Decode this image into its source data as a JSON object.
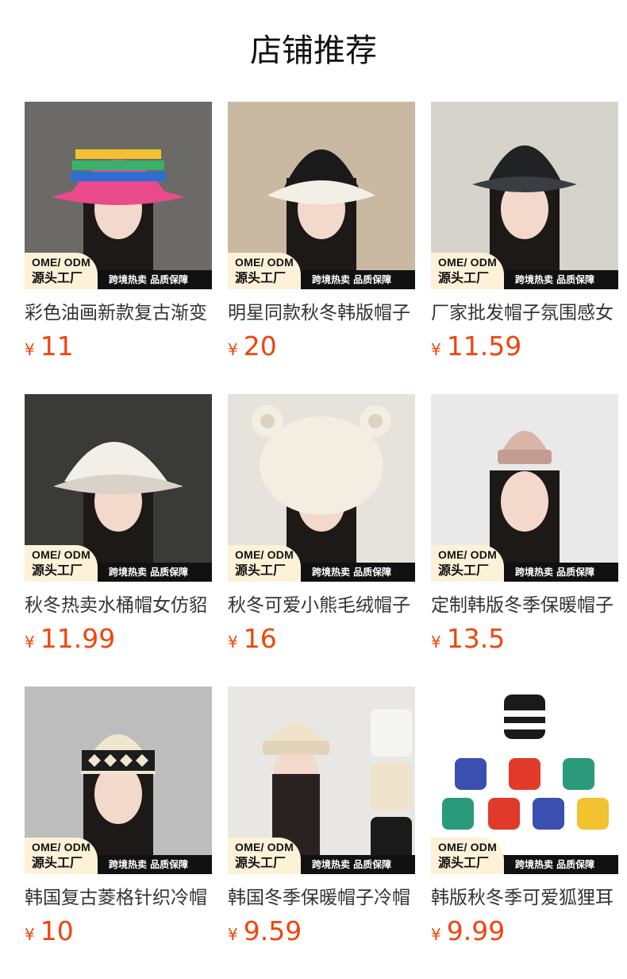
{
  "header": {
    "title": "店铺推荐"
  },
  "badge": {
    "line1": "OME/ ODM",
    "line2": "源头工厂",
    "text": "跨境热卖 品质保障"
  },
  "currency": "¥",
  "products": [
    {
      "name": "彩色油画新款复古渐变",
      "price": "11",
      "image": "rainbow-knit-bucket-hat",
      "colors": [
        "#e84a8a",
        "#f2c230",
        "#3ab06a",
        "#2c6fd1",
        "#f06a2a"
      ]
    },
    {
      "name": "明星同款秋冬韩版帽子",
      "price": "20",
      "image": "black-white-fluffy-bucket-hat",
      "colors": [
        "#1a1a1a",
        "#f4efe6"
      ]
    },
    {
      "name": "厂家批发帽子氛围感女",
      "price": "11.59",
      "image": "black-denim-bucket-hat",
      "colors": [
        "#202224",
        "#3a3d42"
      ]
    },
    {
      "name": "秋冬热卖水桶帽女仿貂",
      "price": "11.99",
      "image": "white-fur-bucket-hat",
      "colors": [
        "#f2eee8",
        "#d9d2c8"
      ]
    },
    {
      "name": "秋冬可爱小熊毛绒帽子",
      "price": "16",
      "image": "bear-ear-plush-hat",
      "colors": [
        "#f3ede2",
        "#ddd2bf"
      ]
    },
    {
      "name": "定制韩版冬季保暖帽子",
      "price": "13.5",
      "image": "pink-knit-beanie",
      "colors": [
        "#d9b5a8",
        "#c49d90"
      ]
    },
    {
      "name": "韩国复古菱格针织冷帽",
      "price": "10",
      "image": "argyle-knit-beanie",
      "colors": [
        "#f0e6cf",
        "#1c1c1c"
      ]
    },
    {
      "name": "韩国冬季保暖帽子冷帽",
      "price": "9.59",
      "image": "cream-knit-beanie",
      "colors": [
        "#efe3cc",
        "#f5f5f3",
        "#1a1a1a"
      ]
    },
    {
      "name": "韩版秋冬季可爱狐狸耳",
      "price": "9.99",
      "image": "fox-ear-striped-beanies",
      "colors": [
        "#1a1a1a",
        "#e23a2a",
        "#2a9a7a",
        "#f2c230",
        "#3a4fb0"
      ]
    }
  ]
}
